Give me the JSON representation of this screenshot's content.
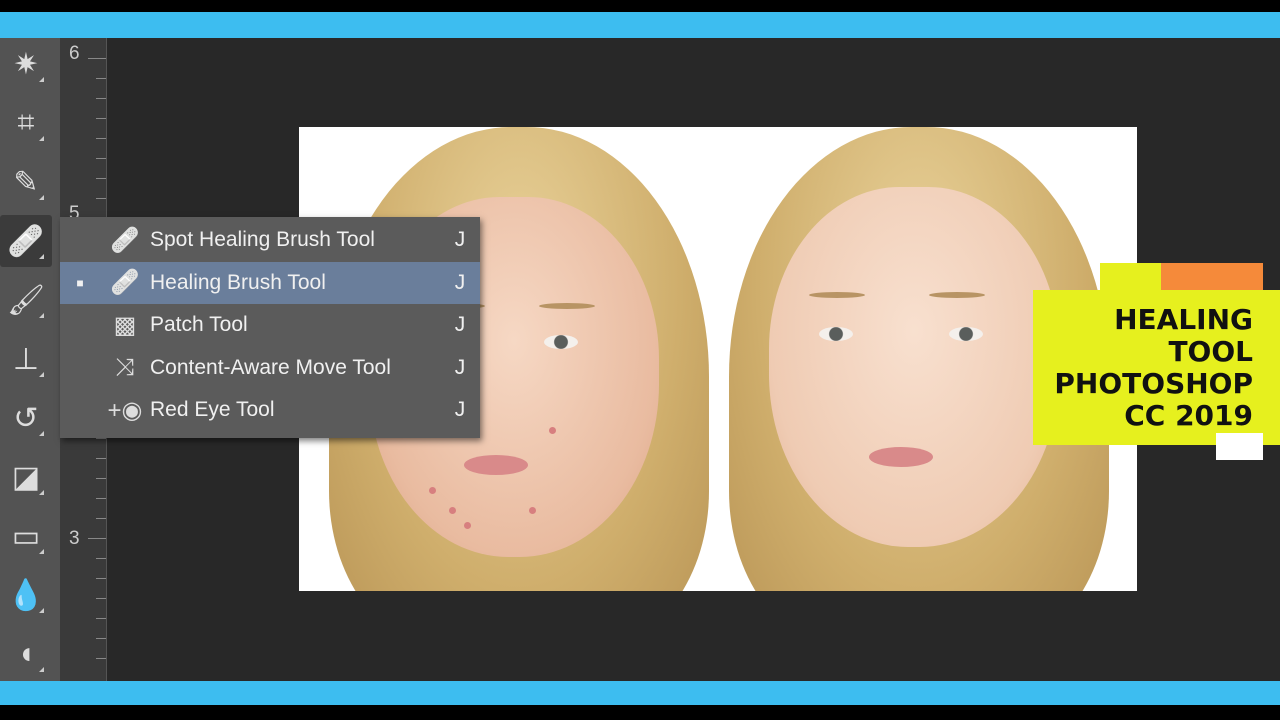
{
  "ruler": {
    "labels": [
      "6",
      "5",
      "3"
    ]
  },
  "toolbar": {
    "tools": [
      {
        "name": "magic-wand",
        "glyph": "✷"
      },
      {
        "name": "crop",
        "glyph": "⌗"
      },
      {
        "name": "eyedropper",
        "glyph": "✎"
      },
      {
        "name": "healing-brush",
        "glyph": "🩹"
      },
      {
        "name": "brush",
        "glyph": "🖌"
      },
      {
        "name": "clone-stamp",
        "glyph": "⊥"
      },
      {
        "name": "history-brush",
        "glyph": "↺"
      },
      {
        "name": "eraser",
        "glyph": "◪"
      },
      {
        "name": "gradient",
        "glyph": "▭"
      },
      {
        "name": "blur",
        "glyph": "💧"
      },
      {
        "name": "dodge",
        "glyph": "◖"
      }
    ]
  },
  "menu": {
    "items": [
      {
        "label": "Spot Healing Brush Tool",
        "shortcut": "J",
        "icon": "spot-healing-brush-icon",
        "glyph": "🩹",
        "selected": false
      },
      {
        "label": "Healing Brush Tool",
        "shortcut": "J",
        "icon": "healing-brush-icon",
        "glyph": "🩹",
        "selected": true
      },
      {
        "label": "Patch Tool",
        "shortcut": "J",
        "icon": "patch-icon",
        "glyph": "▩",
        "selected": false
      },
      {
        "label": "Content-Aware Move Tool",
        "shortcut": "J",
        "icon": "content-aware-move-icon",
        "glyph": "⤨",
        "selected": false
      },
      {
        "label": "Red Eye Tool",
        "shortcut": "J",
        "icon": "red-eye-icon",
        "glyph": "+◉",
        "selected": false
      }
    ],
    "selected_marker": "■"
  },
  "promo": {
    "text": "HEALING\nTOOL\nPHOTOSHOP\nCC 2019"
  },
  "colors": {
    "accent_blue": "#3dbdf0",
    "menu_highlight": "#6a7e9b",
    "promo_yellow": "#e6f01e",
    "promo_orange": "#f58a3a"
  }
}
